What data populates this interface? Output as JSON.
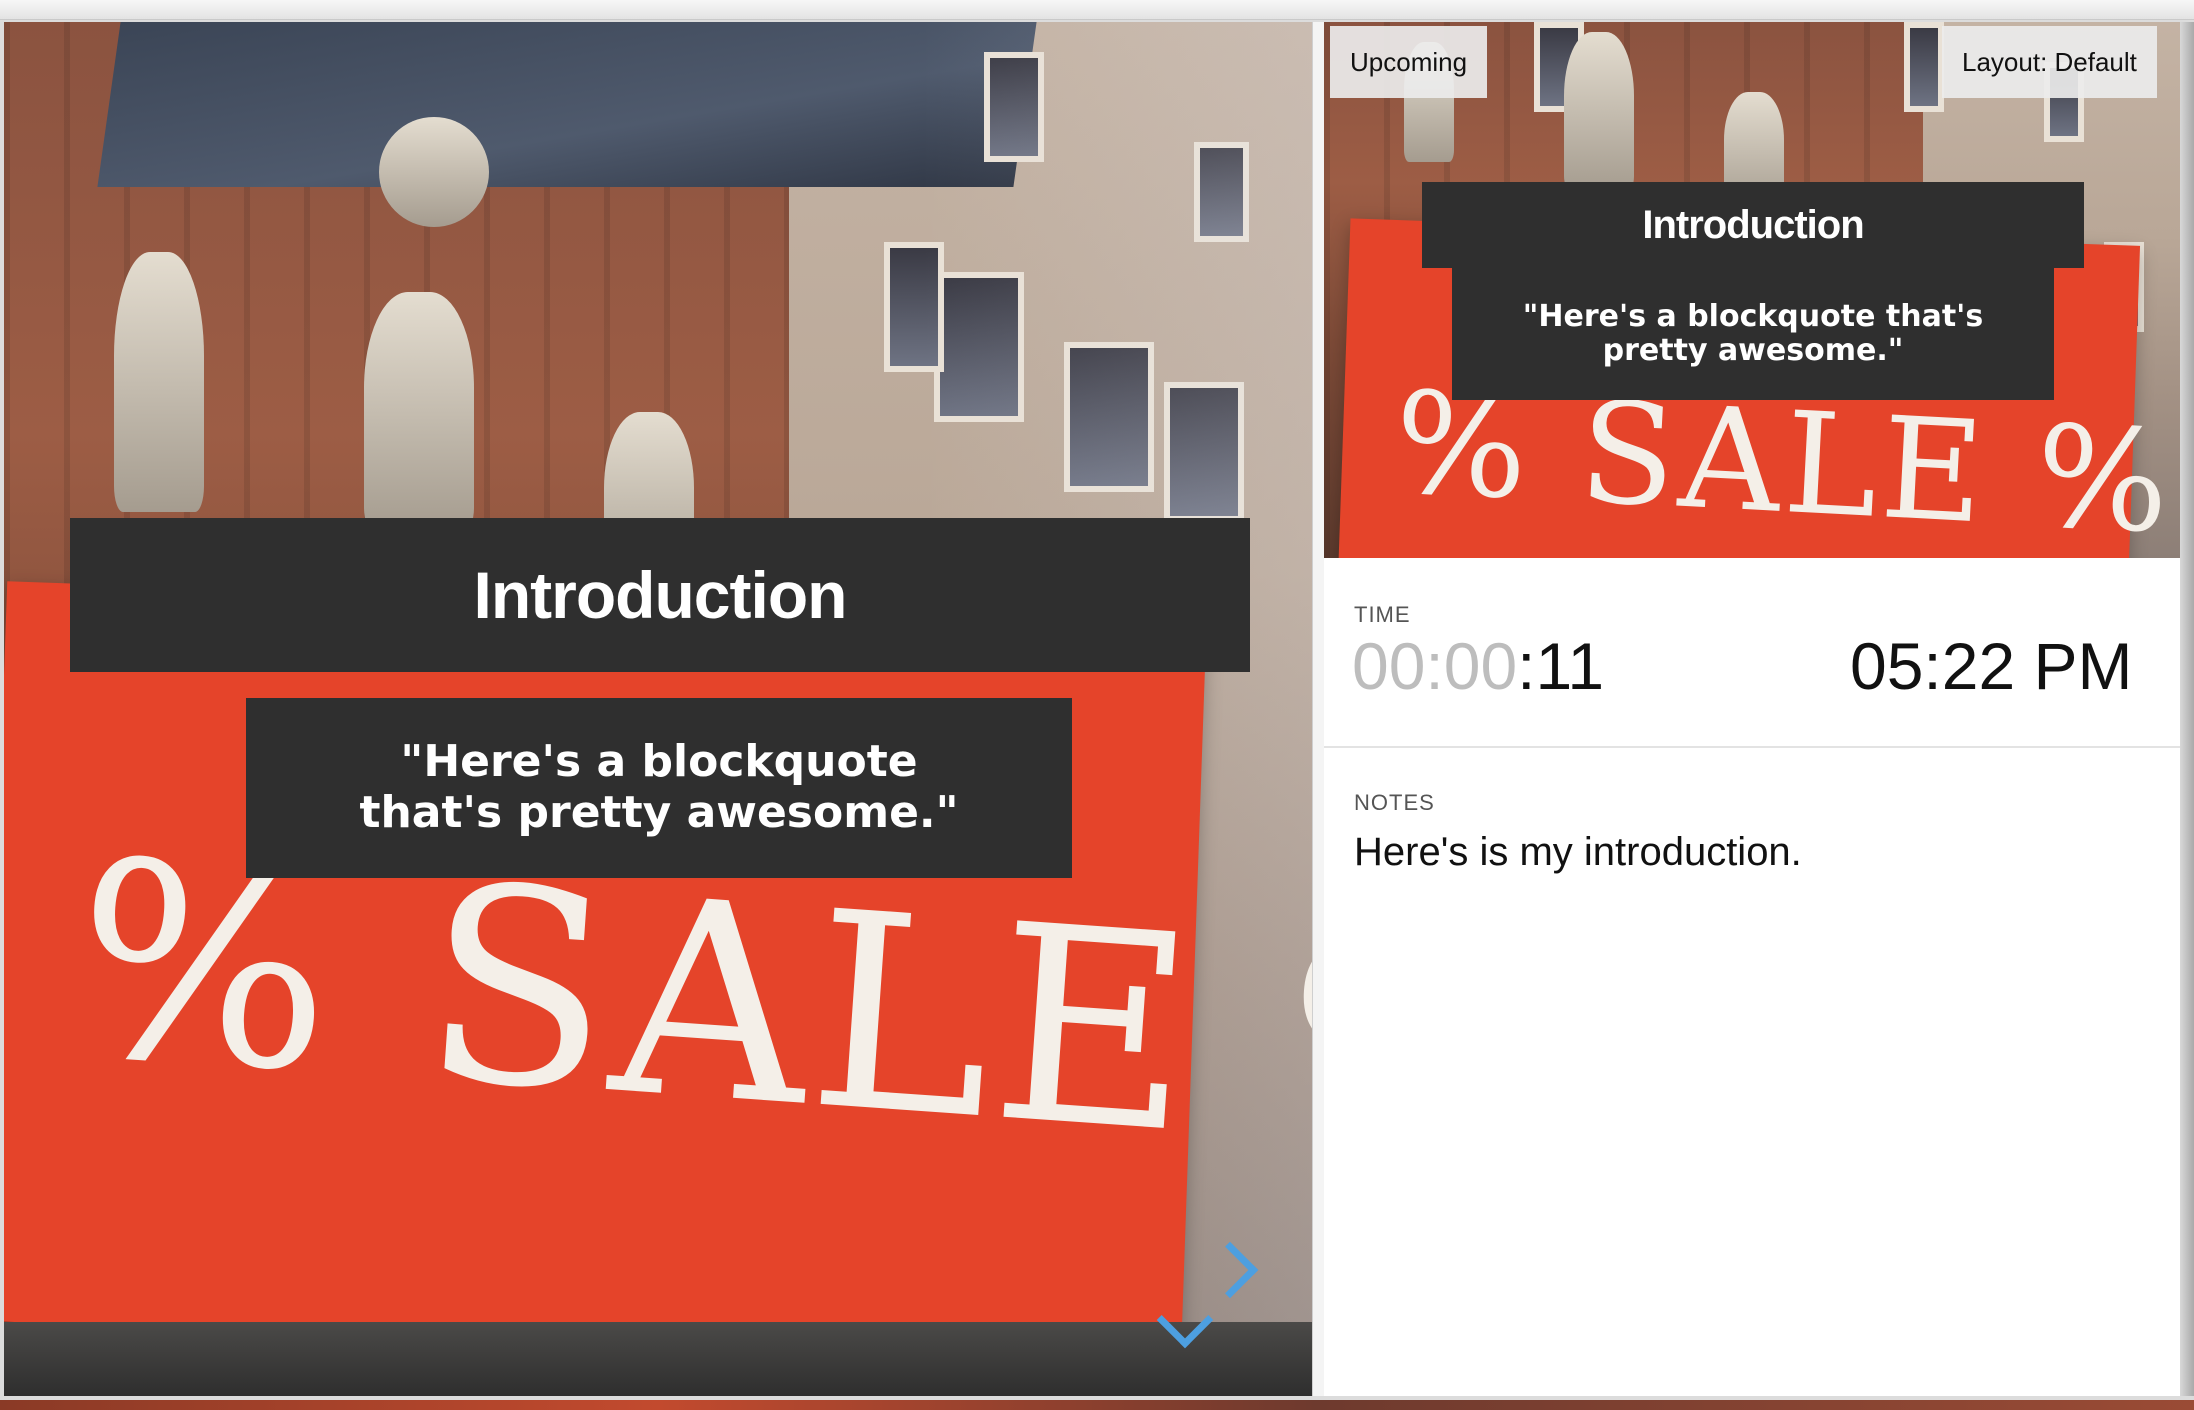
{
  "current_slide": {
    "title": "Introduction",
    "quote": "\"Here's a blockquote that's pretty awesome.\"",
    "sign_text": "% SALE %"
  },
  "preview_slide": {
    "title": "Introduction",
    "quote": "\"Here's a blockquote that's pretty awesome.\"",
    "sign_text": "% SALE %"
  },
  "buttons": {
    "upcoming": "Upcoming",
    "layout": "Layout: Default"
  },
  "time": {
    "label": "TIME",
    "elapsed_muted": "00:00",
    "elapsed_active": ":11",
    "clock": "05:22 PM"
  },
  "notes": {
    "label": "NOTES",
    "text": "Here's is my introduction."
  },
  "nav": {
    "right_icon": "chevron-right-icon",
    "down_icon": "chevron-down-icon",
    "color": "#4d9fe0"
  },
  "colors": {
    "banner": "#e5442a",
    "caption_box": "#2f2f2f"
  }
}
